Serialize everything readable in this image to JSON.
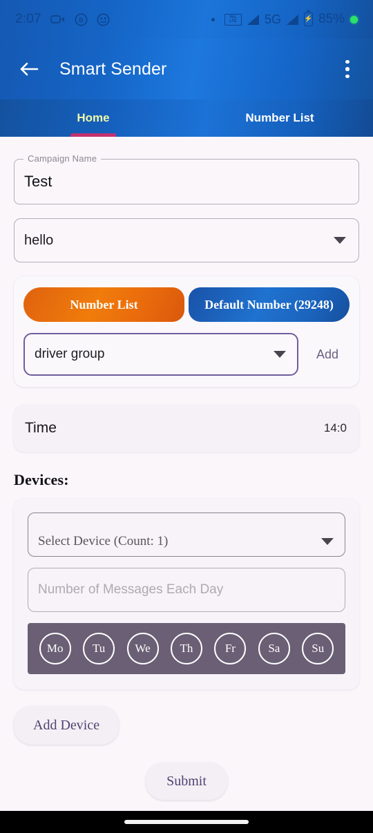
{
  "status_bar": {
    "time": "2:07",
    "icons_left": [
      "video-camera-icon",
      "bitcoin-circle-icon",
      "face-emoji-icon"
    ],
    "volte_line1": "VoL",
    "volte_line2": "LTE",
    "network": "5G",
    "battery_percent": "85%",
    "battery_glyph": "⚡",
    "dot_indicator": "recording-dot"
  },
  "appbar": {
    "title": "Smart Sender",
    "back_icon": "arrow-left-icon",
    "overflow_icon": "kebab-menu-icon"
  },
  "tabs": [
    {
      "label": "Home",
      "active": true
    },
    {
      "label": "Number List",
      "active": false
    }
  ],
  "campaign": {
    "label": "Campaign Name",
    "value": "Test"
  },
  "message_dropdown": {
    "value": "hello",
    "caret_icon": "chevron-down-icon"
  },
  "source_toggle": {
    "number_list_label": "Number List",
    "default_number_label": "Default Number (29248)"
  },
  "group": {
    "value": "driver group",
    "add_label": "Add",
    "caret_icon": "chevron-down-icon"
  },
  "time_row": {
    "label": "Time",
    "value": "14:0"
  },
  "devices": {
    "heading": "Devices:",
    "select_device": "Select Device (Count: 1)",
    "messages_placeholder": "Number of Messages Each Day",
    "messages_value": "",
    "days": [
      "Mo",
      "Tu",
      "We",
      "Th",
      "Fr",
      "Sa",
      "Su"
    ]
  },
  "actions": {
    "add_device": "Add Device",
    "submit": "Submit"
  },
  "colors": {
    "appbar_blue": "#1565c6",
    "tab_active": "#eef8a8",
    "tab_indicator": "#c2316f",
    "orange_gradient_start": "#e0620f",
    "blue_gradient_start": "#1a52a8",
    "focus_purple": "#6f5d9c",
    "daybar_bg": "#6a5f74",
    "page_bg": "#faf6fa"
  }
}
